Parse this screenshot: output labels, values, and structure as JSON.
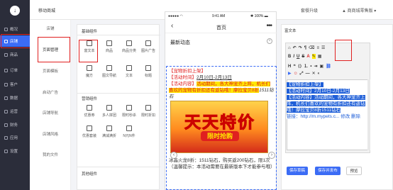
{
  "app": {
    "logo_glyph": "↓",
    "page_title": "移动商城"
  },
  "header": {
    "upgrade_label": "套餐升级",
    "user_label": "▲ 商商城零售版 ▾"
  },
  "sidebar": {
    "items": [
      {
        "label": "概况"
      },
      {
        "label": "店铺",
        "active": true
      },
      {
        "label": "商品"
      },
      {
        "label": "订单"
      },
      {
        "label": "客户"
      },
      {
        "label": "数据"
      },
      {
        "label": "运营"
      },
      {
        "label": "财务"
      },
      {
        "label": "应用"
      },
      {
        "label": "设置"
      }
    ]
  },
  "subnav": {
    "items": [
      {
        "label": "店铺"
      },
      {
        "label": "页面管理",
        "active": true
      },
      {
        "label": "页面模板"
      },
      {
        "label": "启动广告"
      },
      {
        "label": "店铺导航"
      },
      {
        "label": "店铺风格"
      },
      {
        "label": "我的文件"
      }
    ]
  },
  "components": {
    "basic_title": "基础组件",
    "basic": [
      "富文本",
      "商品",
      "商品分类",
      "图片广告",
      "魔方",
      "图文导航",
      "文本",
      "标题"
    ],
    "marketing_title": "营销组件",
    "marketing": [
      "优惠券",
      "多人拼团",
      "限时秒杀",
      "限时折扣",
      "优惠套装",
      "满减满折",
      "N元N件"
    ],
    "other_title": "其他组件"
  },
  "phone": {
    "time": "9:41 AM",
    "carrier": "●●●●● ◠",
    "battery": "✱ 100% ▬",
    "back": "‹",
    "title": "首页",
    "more": "•••",
    "latest": "最新动态",
    "close": "×",
    "line1": "【宠物折扣上架】",
    "time_label": "【活动时间】",
    "time_value": "2月10日-2月13日",
    "content_label": "【活动内容】",
    "content_hl": "活动期间，各大神宠齐上阵，机长们喜欢的宠物有折扣还有返钻哦！摩拉宝贝8折",
    "content_tail": "1511钻石",
    "banner_big": "天天特价",
    "banner_small": "限时抢购",
    "after1": "冰晶火龙8折：1511钻石，购买返200钻石，限1次",
    "after2": "（温馨提示：本活动需要在最新版本下才能参与哦）",
    "prev": "‹",
    "next": "›"
  },
  "editor": {
    "panel_label": "富文本",
    "text1": "【宠物折扣上架】",
    "text2": "【活动时间】2月10日-2月13日",
    "text3": "【活动内容】活动期间，各大神宠齐上阵，机长们喜欢的宠物有折扣还有返钻哦！摩拉宝贝8折1511钻石",
    "link": "链接：http://m.mypets.c...   修改  删除",
    "save": "保存草稿",
    "publish": "保存并发布",
    "preview": "预览"
  }
}
